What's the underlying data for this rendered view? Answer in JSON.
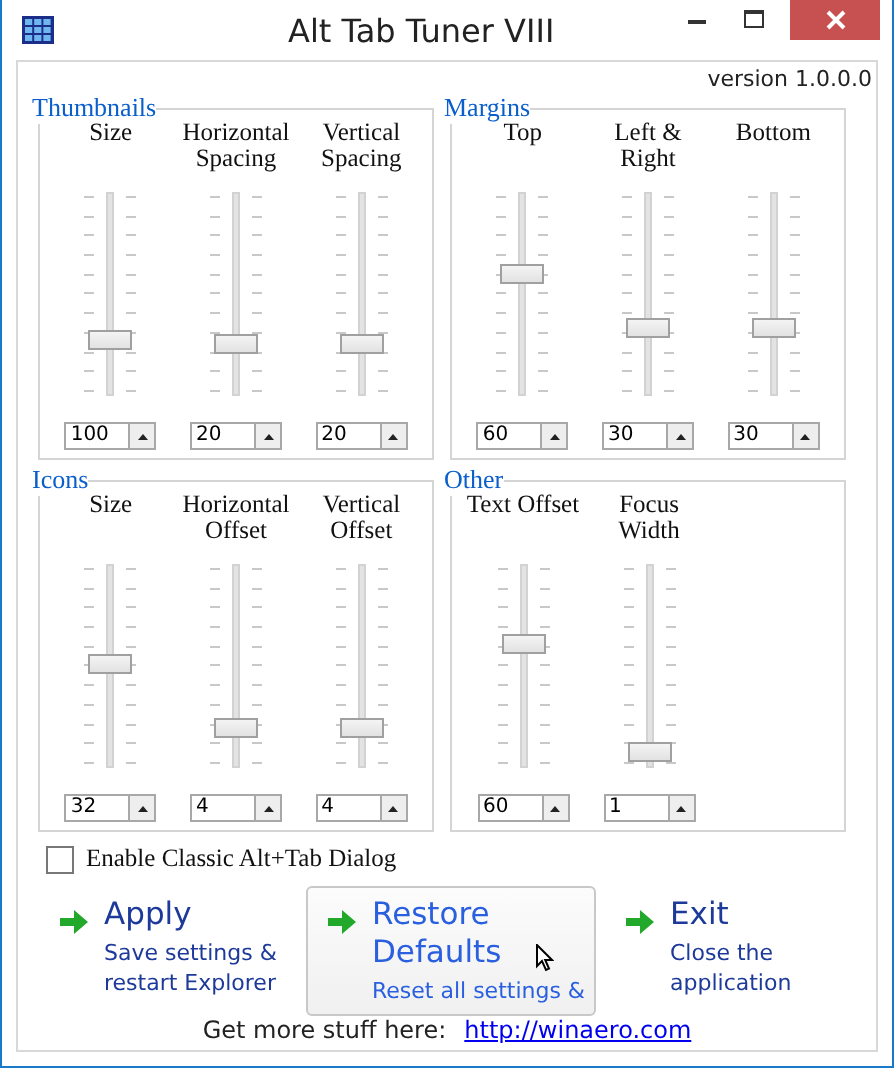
{
  "window": {
    "title": "Alt Tab Tuner VIII"
  },
  "version": "version 1.0.0.0",
  "groups": [
    {
      "title": "Thumbnails",
      "sliders": [
        {
          "label": "Size",
          "level": 0.27,
          "value": "100"
        },
        {
          "label": "Horizontal Spacing",
          "level": 0.24,
          "value": "20"
        },
        {
          "label": "Vertical Spacing",
          "level": 0.24,
          "value": "20"
        }
      ]
    },
    {
      "title": "Margins",
      "sliders": [
        {
          "label": "Top",
          "level": 0.6,
          "value": "60"
        },
        {
          "label": "Left & Right",
          "level": 0.33,
          "value": "30"
        },
        {
          "label": "Bottom",
          "level": 0.33,
          "value": "30"
        }
      ]
    },
    {
      "title": "Icons",
      "sliders": [
        {
          "label": "Size",
          "level": 0.51,
          "value": "32"
        },
        {
          "label": "Horizontal Offset",
          "level": 0.18,
          "value": "4"
        },
        {
          "label": "Vertical Offset",
          "level": 0.18,
          "value": "4"
        }
      ]
    },
    {
      "title": "Other",
      "sliders": [
        {
          "label": "Text Offset",
          "level": 0.61,
          "value": "60"
        },
        {
          "label": "Focus Width",
          "level": 0.06,
          "value": "1"
        }
      ]
    }
  ],
  "checkbox": {
    "label": "Enable Classic Alt+Tab Dialog",
    "checked": false
  },
  "actions": [
    {
      "title": "Apply",
      "description": "Save settings & restart Explorer",
      "hovered": false
    },
    {
      "title": "Restore Defaults",
      "description": "Reset all settings &",
      "hovered": true
    },
    {
      "title": "Exit",
      "description": "Close the application",
      "hovered": false
    }
  ],
  "footer": {
    "text": "Get more stuff here:",
    "link": "http://winaero.com"
  }
}
